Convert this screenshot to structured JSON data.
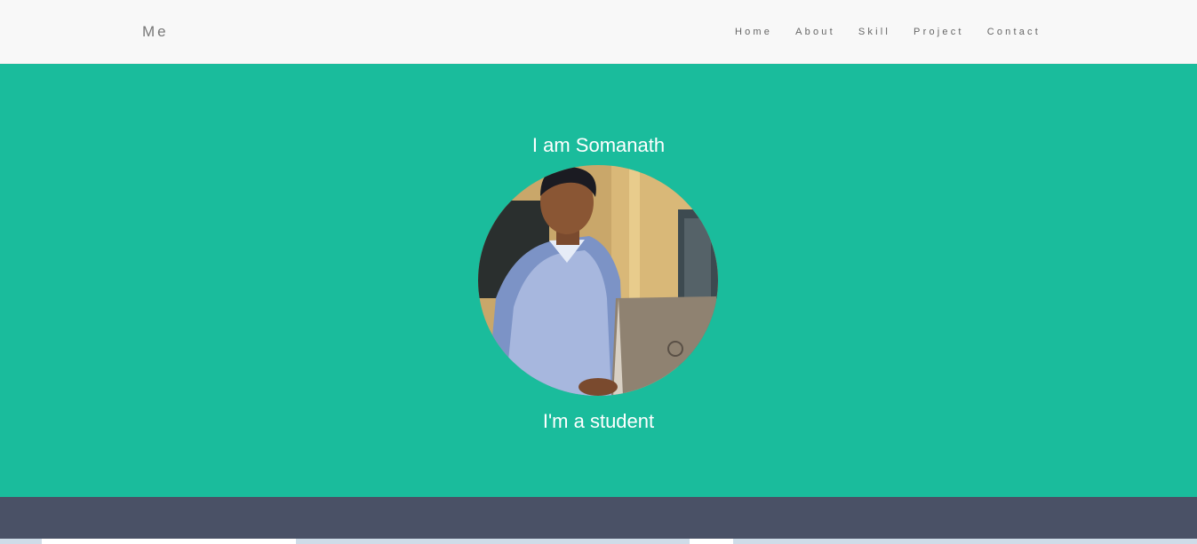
{
  "navbar": {
    "brand": "Me",
    "links": [
      "Home",
      "About",
      "Skill",
      "Project",
      "Contact"
    ]
  },
  "hero": {
    "title": "I am Somanath",
    "subtitle": "I'm a student",
    "background_color": "#1abc9c"
  },
  "icons": {
    "avatar": "profile-photo"
  },
  "colors": {
    "nav_background": "#f8f8f8",
    "dark_band": "#4a5166"
  }
}
